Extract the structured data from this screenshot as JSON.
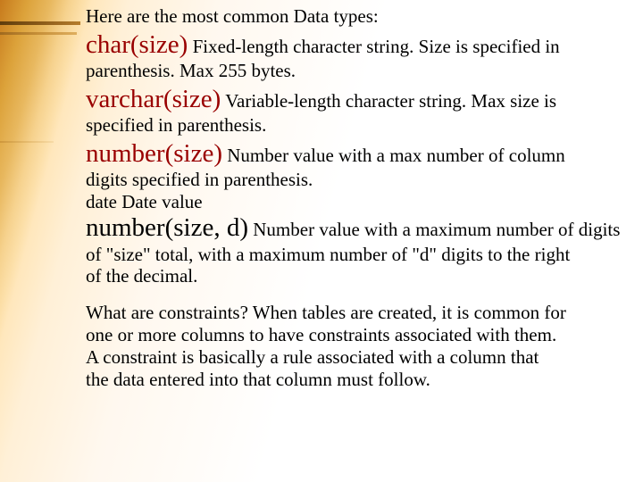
{
  "intro": "Here are the most common Data types:",
  "types": [
    {
      "name": "char(size)",
      "desc_after": " Fixed-length character string. Size is specified in",
      "cont": "parenthesis. Max 255 bytes."
    },
    {
      "name": "varchar(size)",
      "desc_after": " Variable-length character string. Max size is",
      "cont": "specified in parenthesis."
    },
    {
      "name": "number(size)",
      "desc_after": " Number value with a max number of column",
      "cont": " digits specified in parenthesis."
    }
  ],
  "date_line": "date Date value",
  "numberd": {
    "name": "number(size, d)",
    "desc_after": " Number value with a maximum number of digits",
    "cont1": "of \"size\" total, with a maximum number of \"d\" digits to the right",
    "cont2": "of the decimal."
  },
  "constraints": {
    "l1": "What are constraints? When tables are created, it is common for",
    "l2": "one or more columns to have constraints associated with them.",
    "l3": "A constraint is basically a rule associated with a column that",
    "l4": " the data entered into that column must follow."
  }
}
